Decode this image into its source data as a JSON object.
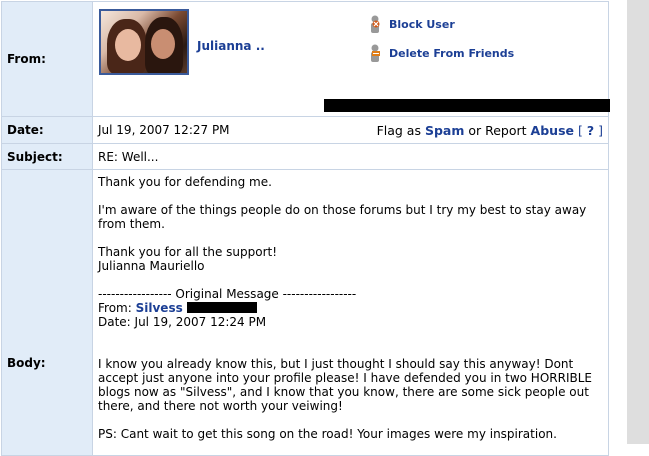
{
  "from_row": {
    "label": "From:",
    "sender_name": "Julianna ..",
    "actions": {
      "block_user": "Block User",
      "delete_friend": "Delete From Friends"
    }
  },
  "date_row": {
    "label": "Date:",
    "value": "Jul 19, 2007 12:27 PM",
    "flag_as": "Flag as",
    "spam": "Spam",
    "or_report": "or Report",
    "abuse": "Abuse",
    "help_open": "[",
    "help": "?",
    "help_close": "]"
  },
  "subject_row": {
    "label": "Subject:",
    "value": "RE: Well..."
  },
  "body_row": {
    "label": "Body:",
    "para1": "Thank you for defending me.",
    "para2": "I'm aware of the things people do on those forums but I try my best to stay away from them.",
    "para3_line1": "Thank you for all the support!",
    "para3_line2": "Julianna Mauriello",
    "original_header": "----------------- Original Message -----------------",
    "orig_from_label": "From:",
    "orig_from_name": "Silvess",
    "orig_date": "Date: Jul 19, 2007 12:24 PM",
    "para4": "I know you already know this, but I just thought I should say this anyway! Dont accept just anyone into your profile please! I have defended you in two HORRIBLE blogs now as \"Silvess\", and I know that you know, there are some sick people out there, and there not worth your veiwing!",
    "para5": "PS: Cant wait to get this song on the road! Your images were my inspiration."
  },
  "colors": {
    "label_bg": "#e1ecf8",
    "border": "#c8d4e4",
    "link": "#1c3f95",
    "scrollbar": "#dedede"
  }
}
